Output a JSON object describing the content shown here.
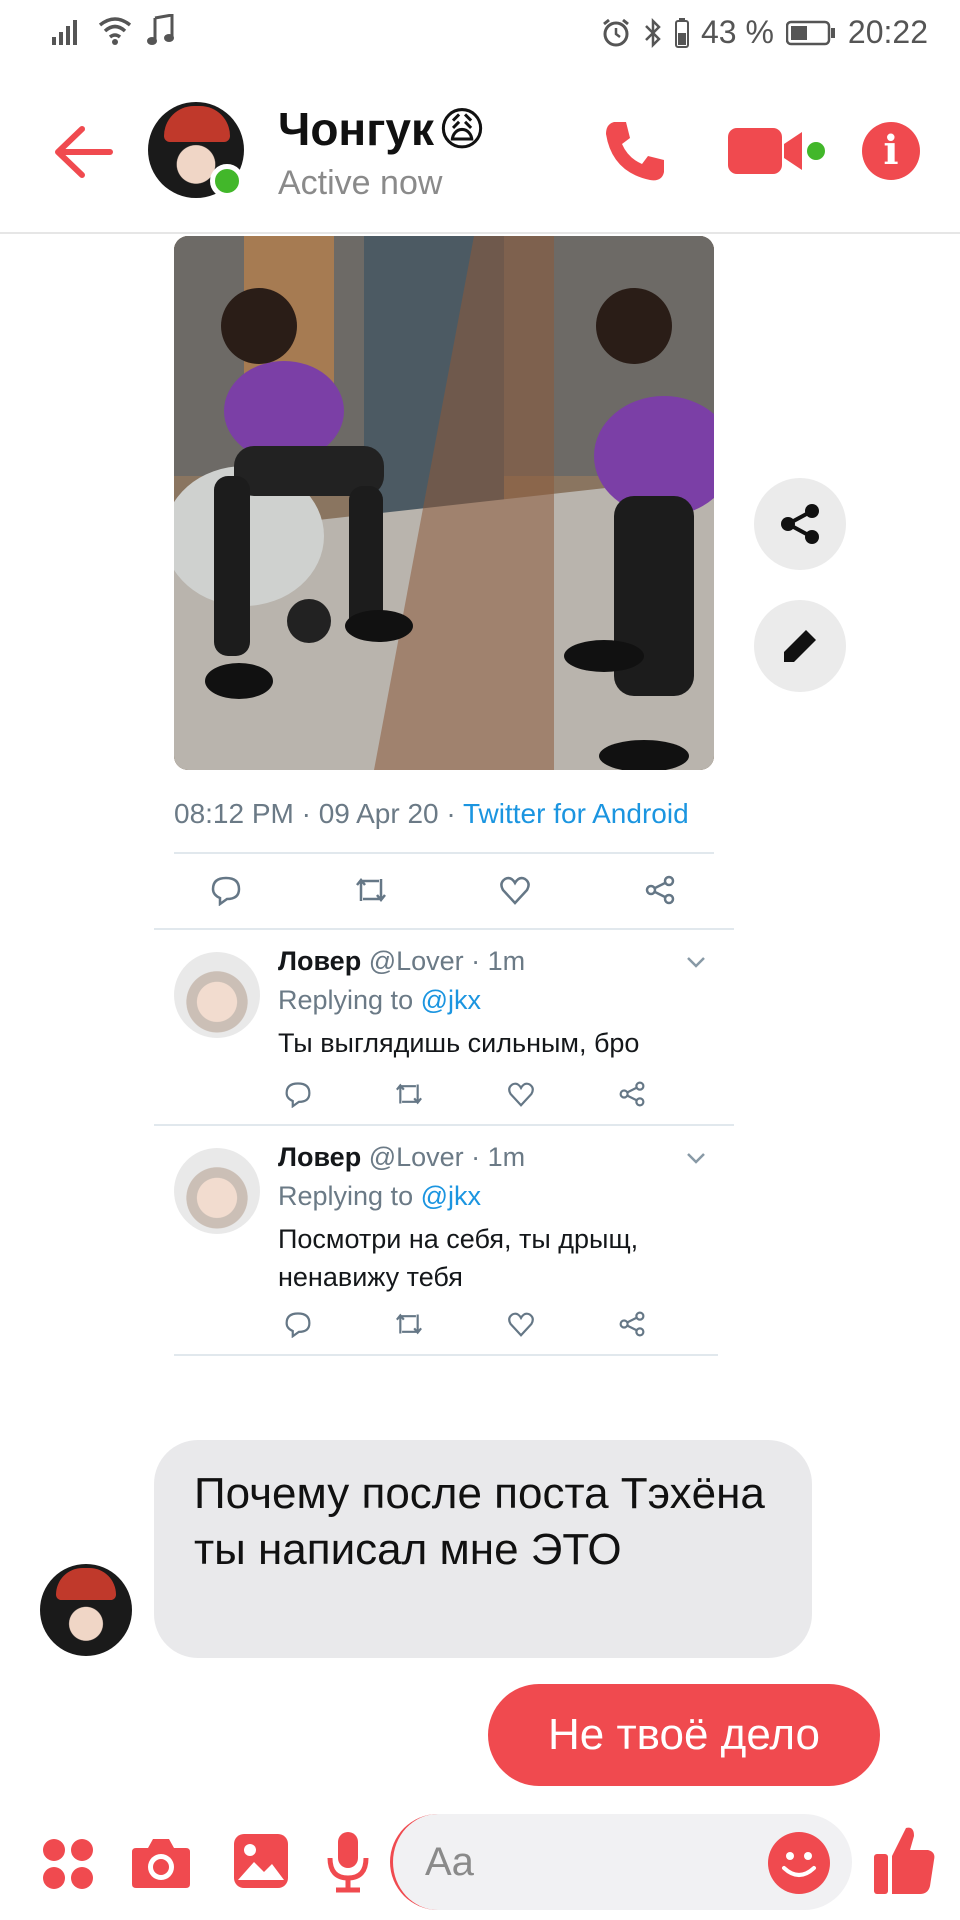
{
  "status_bar": {
    "battery_pct": "43 %",
    "time": "20:22"
  },
  "header": {
    "contact_name": "Чонгук",
    "contact_emoji": "😩",
    "status": "Active now"
  },
  "tweet": {
    "timestamp": "08:12 PM · 09 Apr 20 · ",
    "source": "Twitter for Android"
  },
  "replies": [
    {
      "display_name": "Ловер",
      "meta": " @Lover · 1m",
      "replying_label": "Replying to ",
      "replying_handle": "@jkx",
      "text": "Ты выглядишь сильным, бро"
    },
    {
      "display_name": "Ловер",
      "meta": " @Lover · 1m",
      "replying_label": "Replying to ",
      "replying_handle": "@jkx",
      "text": "Посмотри на себя, ты дрыщ, ненавижу тебя"
    }
  ],
  "messages": {
    "incoming": "Почему после поста Тэхёна ты написал мне ЭТО",
    "outgoing": "Не твоё дело"
  },
  "composer": {
    "placeholder": "Aa"
  },
  "colors": {
    "accent": "#f04a4f",
    "online": "#42b72a",
    "twitter_blue": "#1b95e0",
    "incoming_bubble": "#e9e9eb"
  }
}
